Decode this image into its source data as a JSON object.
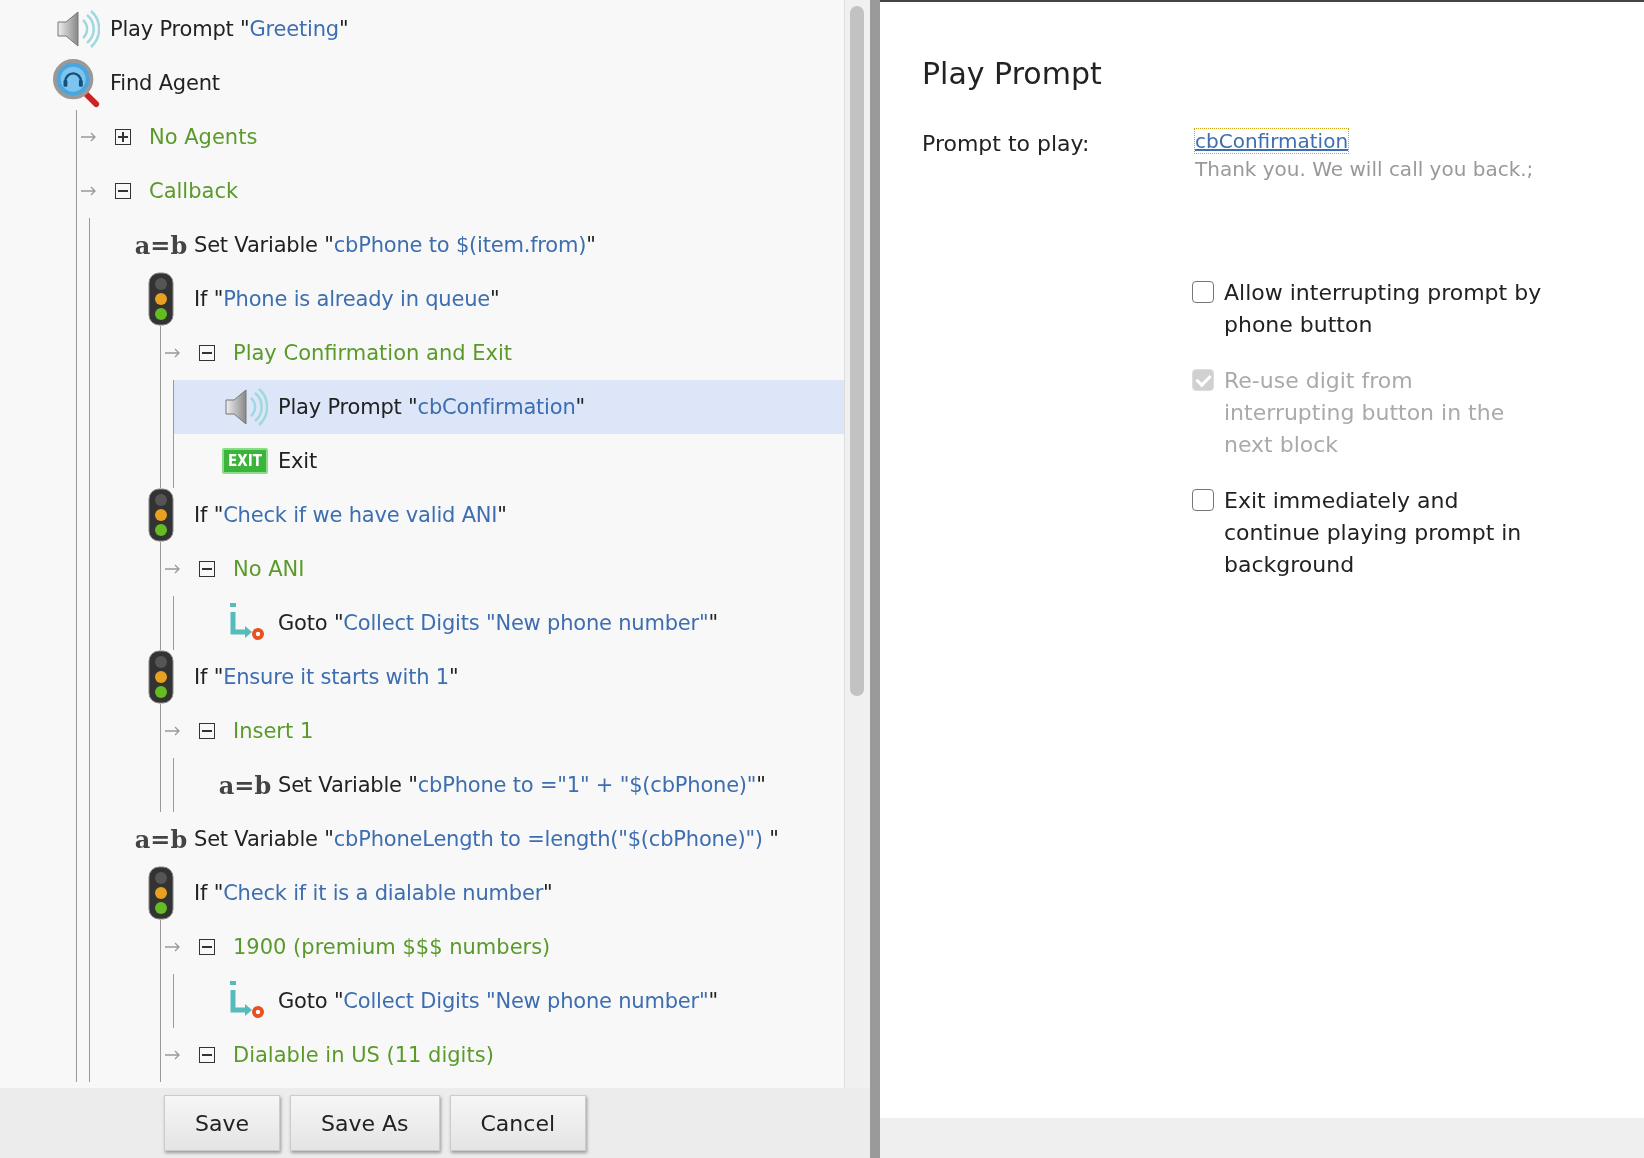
{
  "tree": [
    {
      "kind": "prompt",
      "prefix": "Play Prompt \"",
      "value": "Greeting",
      "suffix": "\"",
      "selected": false
    },
    {
      "kind": "find-agent",
      "prefix": "Find Agent",
      "selected": false,
      "children": [
        {
          "kind": "branch",
          "label": "No Agents",
          "expanded": false
        },
        {
          "kind": "branch",
          "label": "Callback",
          "expanded": true,
          "children": [
            {
              "kind": "set-variable",
              "badge": "a=b",
              "prefix": "Set Variable \"",
              "value": "cbPhone to $(item.from)",
              "suffix": "\"",
              "selected": false
            },
            {
              "kind": "if",
              "prefix": "If \"",
              "value": "Phone is already in queue",
              "suffix": "\"",
              "selected": false,
              "children": [
                {
                  "kind": "branch",
                  "label": "Play Confirmation and Exit",
                  "expanded": true,
                  "children": [
                    {
                      "kind": "prompt",
                      "prefix": "Play Prompt \"",
                      "value": "cbConfirmation",
                      "suffix": "\"",
                      "selected": true
                    },
                    {
                      "kind": "exit",
                      "badge": "EXIT",
                      "prefix": "Exit",
                      "selected": false
                    }
                  ]
                }
              ]
            },
            {
              "kind": "if",
              "prefix": "If \"",
              "value": "Check if we have valid ANI",
              "suffix": "\"",
              "selected": false,
              "children": [
                {
                  "kind": "branch",
                  "label": "No ANI",
                  "expanded": true,
                  "children": [
                    {
                      "kind": "goto",
                      "prefix": "Goto \"",
                      "value": "Collect Digits \"New phone number\"",
                      "suffix": "\"",
                      "selected": false
                    }
                  ]
                }
              ]
            },
            {
              "kind": "if",
              "prefix": "If \"",
              "value": "Ensure it starts with 1",
              "suffix": "\"",
              "selected": false,
              "children": [
                {
                  "kind": "branch",
                  "label": "Insert 1",
                  "expanded": true,
                  "children": [
                    {
                      "kind": "set-variable",
                      "badge": "a=b",
                      "prefix": "Set Variable \"",
                      "value": "cbPhone to =\"1\" + \"$(cbPhone)\"",
                      "suffix": "\"",
                      "selected": false
                    }
                  ]
                }
              ]
            },
            {
              "kind": "set-variable",
              "badge": "a=b",
              "prefix": "Set Variable \"",
              "value": "cbPhoneLength to =length(\"$(cbPhone)\") ",
              "suffix": "\"",
              "selected": false
            },
            {
              "kind": "if",
              "prefix": "If \"",
              "value": "Check if it is a dialable number",
              "suffix": "\"",
              "selected": false,
              "children": [
                {
                  "kind": "branch",
                  "label": "1900 (premium $$$ numbers)",
                  "expanded": true,
                  "children": [
                    {
                      "kind": "goto",
                      "prefix": "Goto \"",
                      "value": "Collect Digits \"New phone number\"",
                      "suffix": "\"",
                      "selected": false
                    }
                  ]
                },
                {
                  "kind": "branch",
                  "label": "Dialable in US (11 digits)",
                  "expanded": true
                }
              ]
            }
          ]
        }
      ]
    }
  ],
  "buttons": [
    "Save",
    "Save As",
    "Cancel"
  ],
  "properties": {
    "title": "Play Prompt",
    "field_label": "Prompt to play:",
    "prompt_link": "cbConfirmation",
    "prompt_text": "Thank you. We will call you back.;",
    "options": [
      {
        "label": "Allow interrupting prompt by phone button",
        "checked": false,
        "disabled": false
      },
      {
        "label": "Re-use digit from interrupting button in the next block",
        "checked": true,
        "disabled": true
      },
      {
        "label": "Exit immediately and continue playing prompt in background",
        "checked": false,
        "disabled": false
      }
    ]
  }
}
